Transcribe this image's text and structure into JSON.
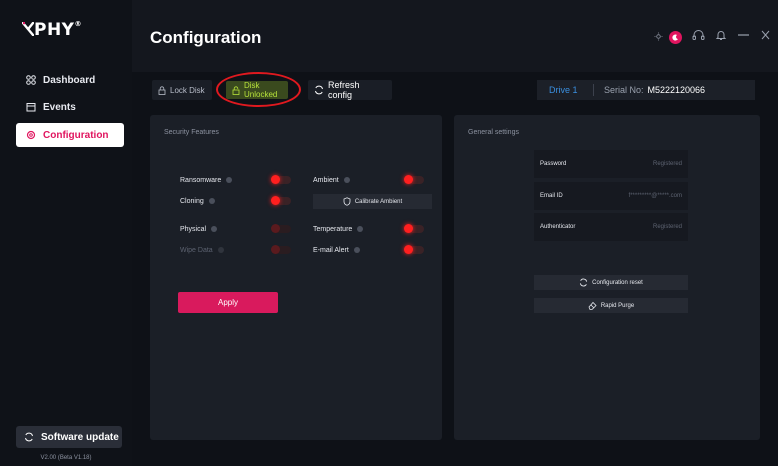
{
  "app": {
    "logo": "PHY",
    "logo_mark": "®"
  },
  "sidebar": {
    "items": [
      {
        "label": "Dashboard",
        "icon": "grid-icon"
      },
      {
        "label": "Events",
        "icon": "calendar-icon"
      },
      {
        "label": "Configuration",
        "icon": "gear-icon"
      }
    ],
    "software_update": "Software update",
    "version": "V2.00 (Beta V1.18)"
  },
  "header": {
    "title": "Configuration"
  },
  "toolbar": {
    "lock_label": "Lock Disk",
    "unlock_label": "Disk Unlocked",
    "refresh_label": "Refresh config",
    "drive_label": "Drive 1",
    "serial_label": "Serial No:",
    "serial_value": "M5222120066"
  },
  "security": {
    "title": "Security Features",
    "features": [
      {
        "label": "Ransomware",
        "enabled": true,
        "disabled_text": false
      },
      {
        "label": "Cloning",
        "enabled": true,
        "disabled_text": false
      },
      {
        "label": "Physical",
        "enabled": false,
        "disabled_text": false
      },
      {
        "label": "Wipe Data",
        "enabled": false,
        "disabled_text": true
      },
      {
        "label": "Ambient",
        "enabled": true,
        "disabled_text": false
      },
      {
        "label": "Temperature",
        "enabled": true,
        "disabled_text": false
      },
      {
        "label": "E-mail Alert",
        "enabled": true,
        "disabled_text": false
      }
    ],
    "calibrate_label": "Calibrate Ambient",
    "apply_label": "Apply"
  },
  "general": {
    "title": "General settings",
    "fields": [
      {
        "label": "Password",
        "value": "Registered"
      },
      {
        "label": "Email ID",
        "value": "f*********@*****.com"
      },
      {
        "label": "Authenticator",
        "value": "Registered"
      }
    ],
    "config_reset_label": "Configuration reset",
    "rapid_purge_label": "Rapid Purge"
  },
  "colors": {
    "accent": "#d91a5d",
    "toggle_on": "#ff1f1f",
    "unlocked": "#b7e23a",
    "drive": "#3a8fdf"
  }
}
